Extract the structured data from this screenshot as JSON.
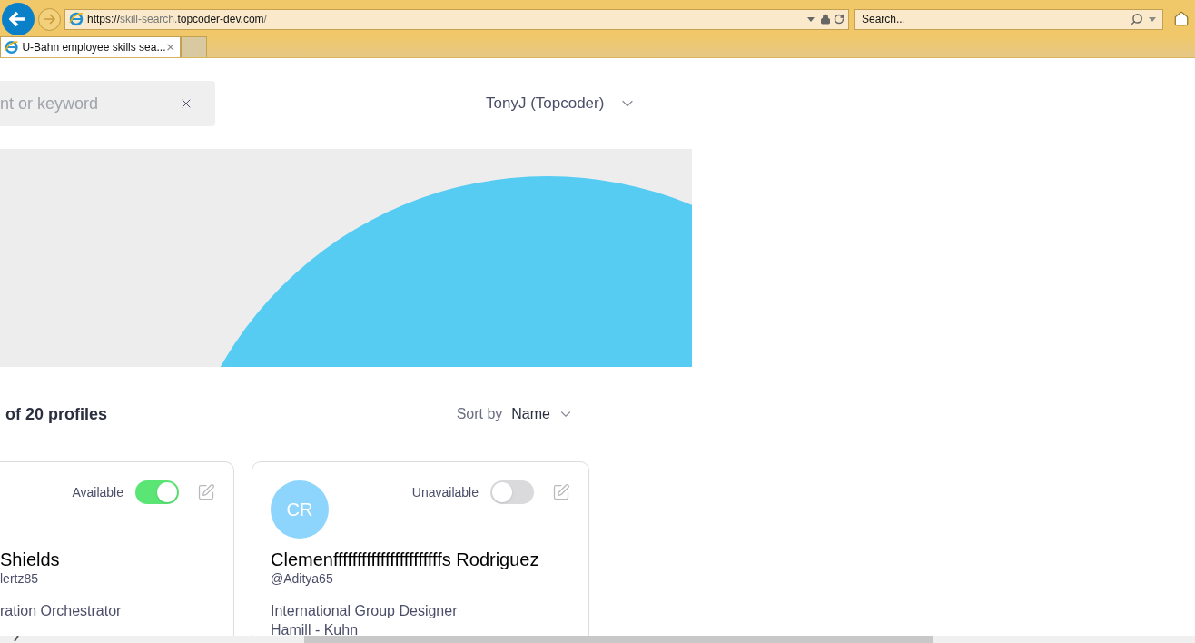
{
  "browser": {
    "address": [
      {
        "text": "https://",
        "dim": false
      },
      {
        "text": "skill-search.",
        "dim": true
      },
      {
        "text": "topcoder-dev.com",
        "dim": false
      },
      {
        "text": "/",
        "dim": true
      }
    ],
    "search": {
      "placeholder": "Search..."
    },
    "tabs": [
      {
        "title": "U-Bahn employee skills sea...",
        "selected": true
      }
    ]
  },
  "header": {
    "search": {
      "placeholder": "nt or keyword"
    },
    "user": "TonyJ (Topcoder)"
  },
  "results": {
    "count": "of 20 profiles",
    "sort_label": "Sort by",
    "sort_value": "Name"
  },
  "cards": [
    {
      "availability": "Available",
      "available": true,
      "name": "Shields",
      "handle": "lertz85",
      "title": "ration Orchestrator"
    },
    {
      "initials": "CR",
      "availability": "Unavailable",
      "available": false,
      "name": "Clemenfffffffffffffffffffffffs Rodriguez",
      "handle": "@Aditya65",
      "title": "International Group Designer",
      "company": "Hamill - Kuhn"
    }
  ]
}
